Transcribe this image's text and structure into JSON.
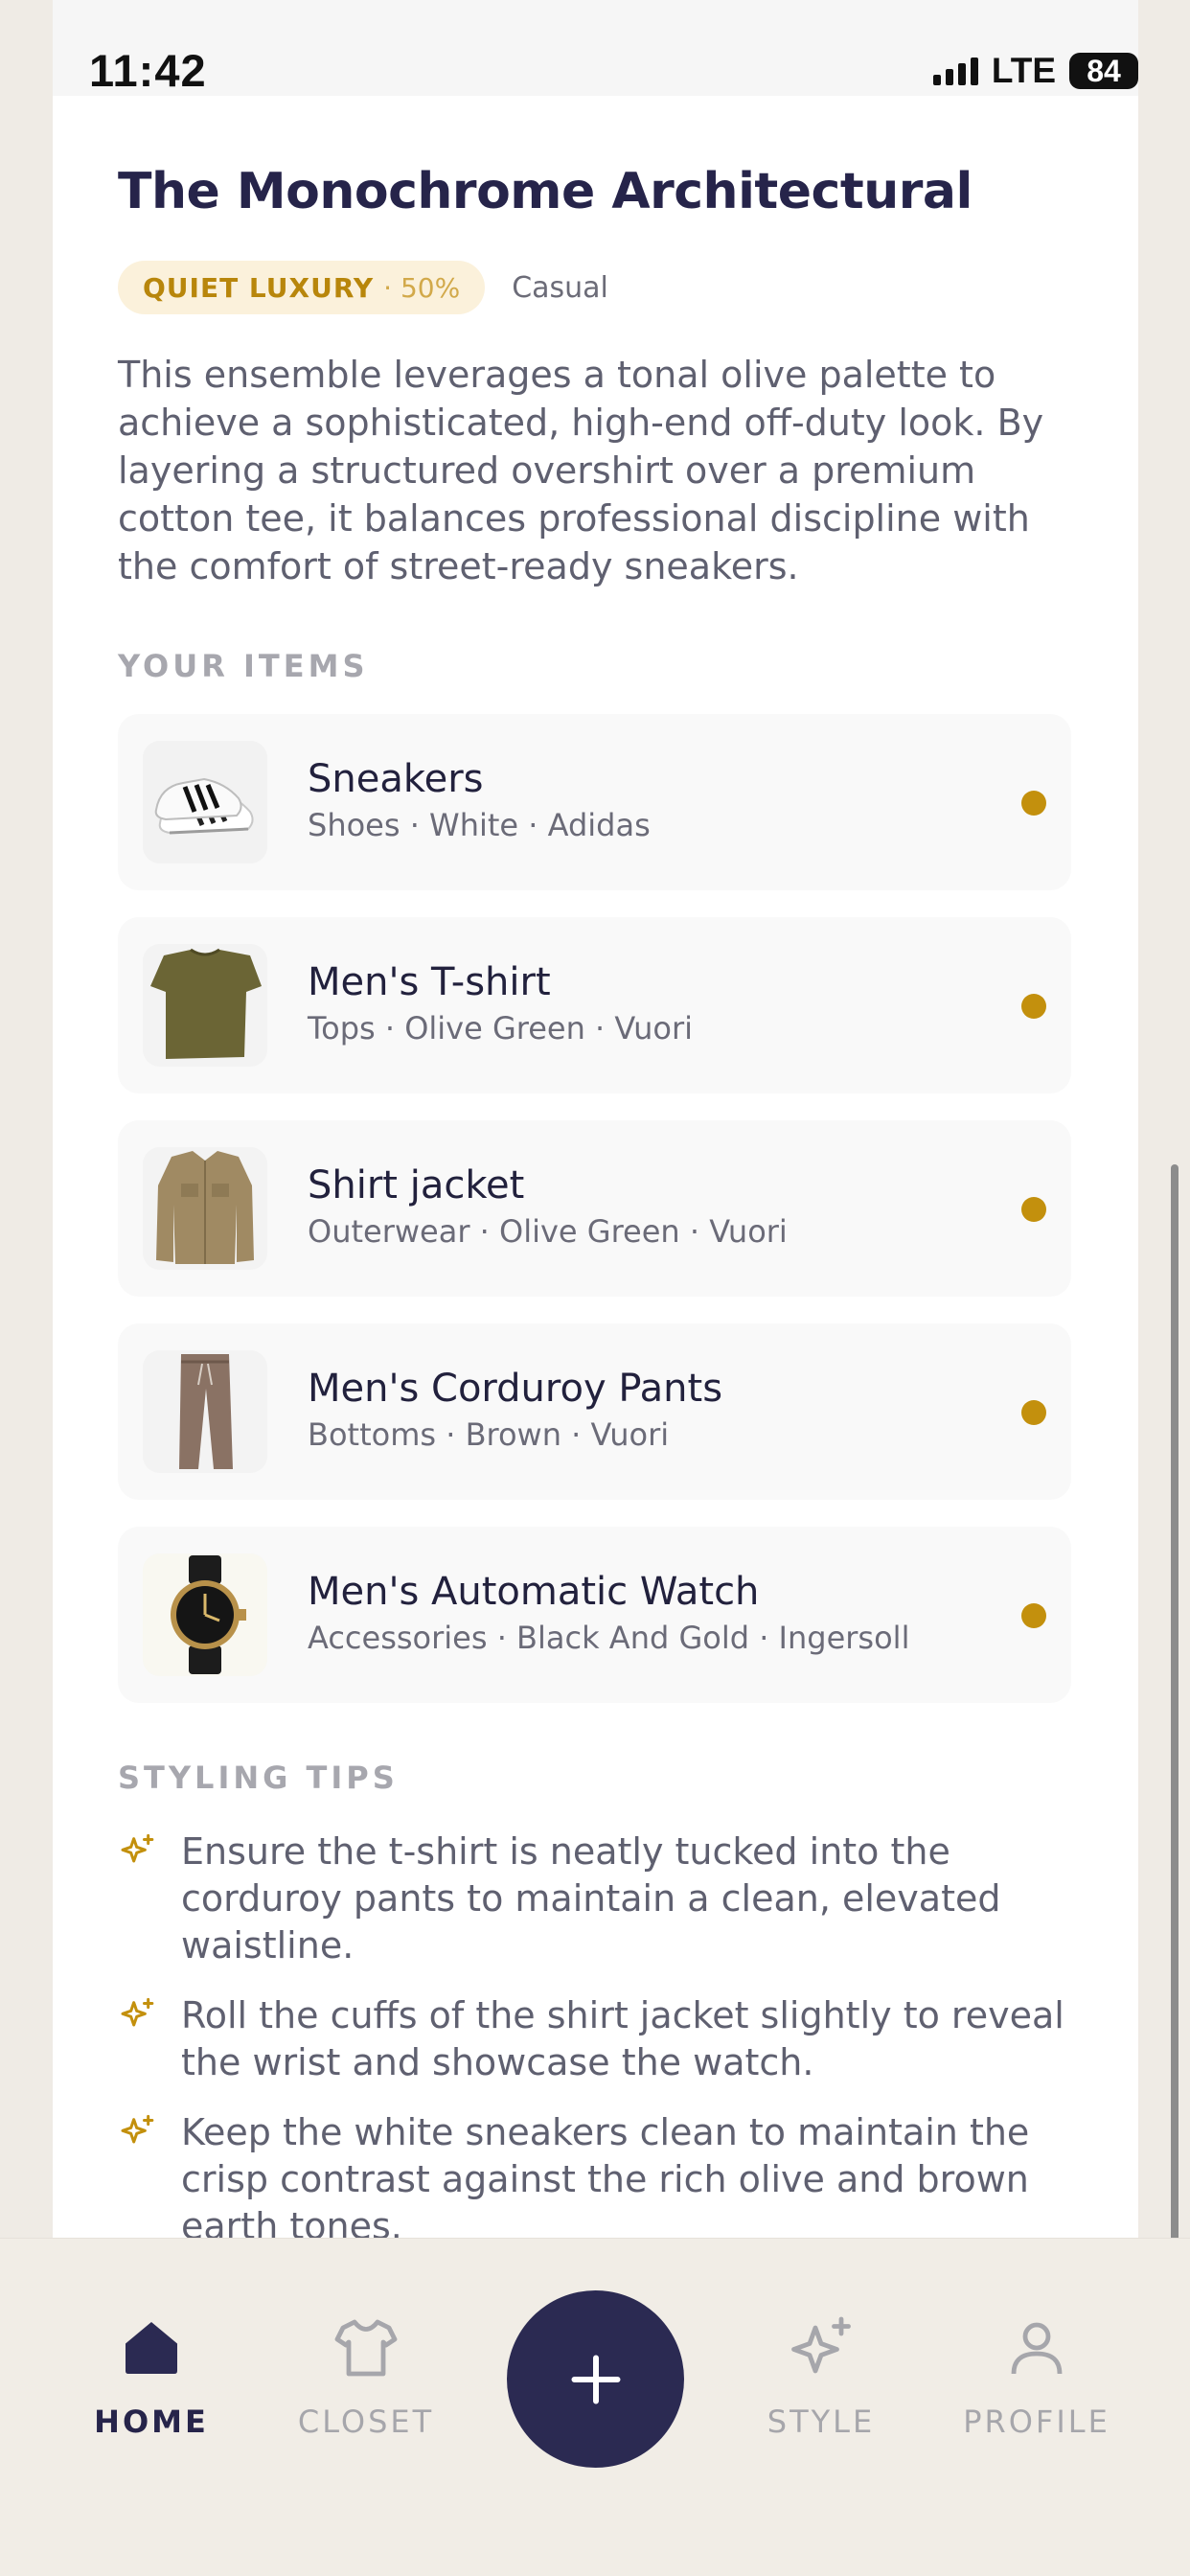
{
  "status": {
    "time": "11:42",
    "network": "LTE",
    "battery": "84"
  },
  "outfit": {
    "title": "The Monochrome Architectural",
    "style_tag": "QUIET LUXURY",
    "style_pct": "· 50%",
    "occasion": "Casual",
    "description": "This ensemble leverages a tonal olive palette to achieve a sophisticated, high-end off-duty look. By layering a structured overshirt over a premium cotton tee, it balances professional discipline with the comfort of street-ready sneakers."
  },
  "items_label": "YOUR ITEMS",
  "items": [
    {
      "name": "Sneakers",
      "meta": "Shoes · White · Adidas",
      "icon": "sneakers"
    },
    {
      "name": "Men's T-shirt",
      "meta": "Tops · Olive Green · Vuori",
      "icon": "tshirt"
    },
    {
      "name": "Shirt jacket",
      "meta": "Outerwear · Olive Green · Vuori",
      "icon": "shirt-jacket"
    },
    {
      "name": "Men's Corduroy Pants",
      "meta": "Bottoms · Brown · Vuori",
      "icon": "pants"
    },
    {
      "name": "Men's Automatic Watch",
      "meta": "Accessories · Black And Gold · Ingersoll",
      "icon": "watch"
    }
  ],
  "tips_label": "STYLING TIPS",
  "tips": [
    "Ensure the t-shirt is neatly tucked into the corduroy pants to maintain a clean, elevated waistline.",
    "Roll the cuffs of the shirt jacket slightly to reveal the wrist and showcase the watch.",
    "Keep the white sneakers clean to maintain the crisp contrast against the rich olive and brown earth tones."
  ],
  "nav": {
    "home": "HOME",
    "closet": "CLOSET",
    "style": "STYLE",
    "profile": "PROFILE",
    "add_icon": "plus-icon"
  },
  "colors": {
    "accent": "#c3900d",
    "primary": "#2b2a52",
    "tag_bg": "#fbf1db"
  }
}
